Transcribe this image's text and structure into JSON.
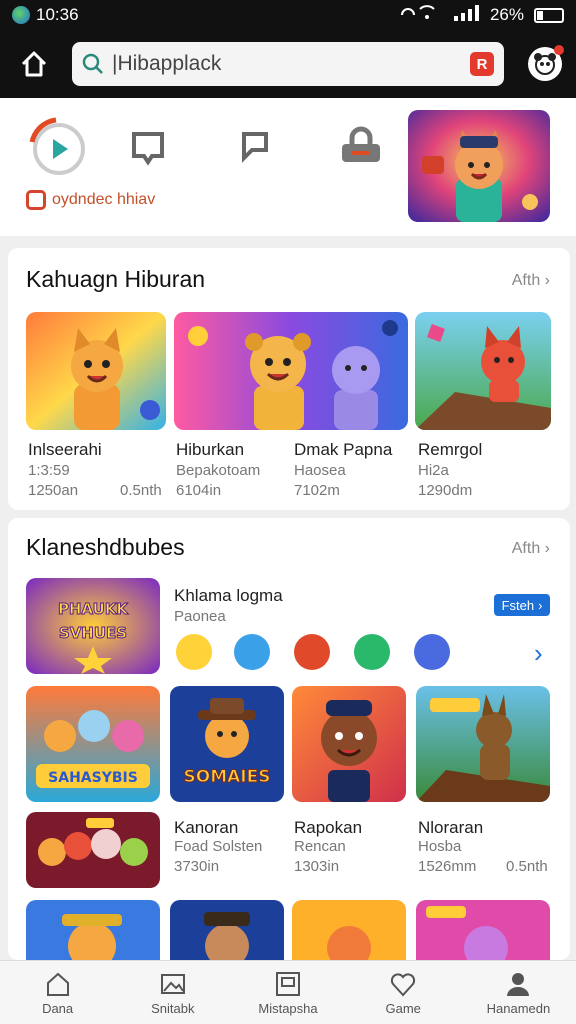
{
  "status": {
    "time": "10:36",
    "battery": "26%"
  },
  "search": {
    "value": "|Hibapplack",
    "badge": "R"
  },
  "quick": {
    "brand_text": "oydndec hhiav"
  },
  "section1": {
    "title": "Kahuagn Hiburan",
    "more": "Afth",
    "tiles": [
      {
        "name": "Inlseerahi",
        "sub1": "1:3:59",
        "sub2": "1250an",
        "sub3": "0.5nth"
      },
      {
        "name": "Hiburkan",
        "sub1": "Bepakotoam",
        "sub2": "6104in"
      },
      {
        "name": "Dmak Papna",
        "sub1": "Haosea",
        "sub2": "7102m"
      },
      {
        "name": "Remrgol",
        "sub1": "Hi2a",
        "sub2": "1290dm"
      }
    ]
  },
  "section2": {
    "title": "Klaneshdbubes",
    "more": "Afth",
    "feature": {
      "title": "Khlama logma",
      "sub": "Paonea",
      "button": "Fsteh",
      "banner": "PHAUKK SVHUES"
    },
    "grid_row1": [
      {
        "name": "",
        "banner": "SAHASYBIS"
      },
      {
        "name": "",
        "banner": "SOMAIES"
      },
      {
        "name": "",
        "banner": ""
      },
      {
        "name": "",
        "banner": ""
      }
    ],
    "row2": [
      {
        "name": "Kanoran",
        "sub1": "Foad Solsten",
        "sub2": "3730in"
      },
      {
        "name": "Rapokan",
        "sub1": "Rencan",
        "sub2": "1303in"
      },
      {
        "name": "Nloraran",
        "sub1": "Hosba",
        "sub2": "1526mm",
        "sub3": "0.5nth"
      }
    ]
  },
  "nav": [
    {
      "label": "Dana",
      "icon": "home-icon"
    },
    {
      "label": "Snitabk",
      "icon": "image-icon"
    },
    {
      "label": "Mistapsha",
      "icon": "media-icon"
    },
    {
      "label": "Game",
      "icon": "heart-icon"
    },
    {
      "label": "Hanamedn",
      "icon": "profile-icon"
    }
  ],
  "colors": {
    "accent": "#1b6fd6",
    "badge": "#e43a2e"
  }
}
